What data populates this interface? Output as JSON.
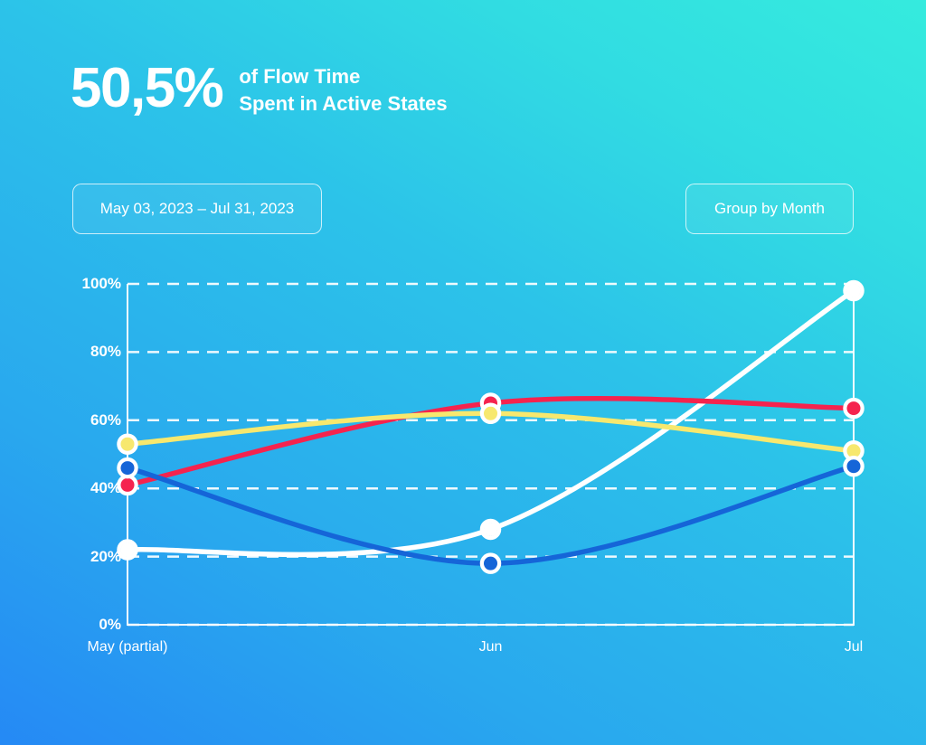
{
  "headline": {
    "stat": "50,5%",
    "line1": "of Flow Time",
    "line2": "Spent in Active States"
  },
  "controls": {
    "date_range": "May 03, 2023 – Jul 31, 2023",
    "group_by": "Group by Month"
  },
  "colors": {
    "background_from": "#2589F5",
    "background_to": "#35EBDE",
    "series_yellow": "#F7E86E",
    "series_blue": "#1565D8",
    "series_red": "#F5234E",
    "series_white": "#FFFFFF",
    "gridline": "#FFFFFF",
    "axis": "#FFFFFF"
  },
  "chart_data": {
    "type": "line",
    "title": "",
    "xlabel": "",
    "ylabel": "",
    "categories": [
      "May (partial)",
      "Jun",
      "Jul"
    ],
    "ylim": [
      0,
      100
    ],
    "yticks": [
      "0%",
      "20%",
      "40%",
      "60%",
      "80%",
      "100%"
    ],
    "ytick_values": [
      0,
      20,
      40,
      60,
      80,
      100
    ],
    "grid": true,
    "grid_style": "dashed-horizontal",
    "legend": "none",
    "smoothing": "spline",
    "markers": "circle-white-ring",
    "series": [
      {
        "name": "white",
        "color": "#FFFFFF",
        "values": [
          22,
          28,
          98
        ]
      },
      {
        "name": "red",
        "color": "#F5234E",
        "values": [
          41,
          65,
          63.5
        ]
      },
      {
        "name": "yellow",
        "color": "#F7E86E",
        "values": [
          53,
          62,
          51
        ]
      },
      {
        "name": "blue",
        "color": "#1565D8",
        "values": [
          46,
          18,
          46.5
        ]
      }
    ]
  }
}
